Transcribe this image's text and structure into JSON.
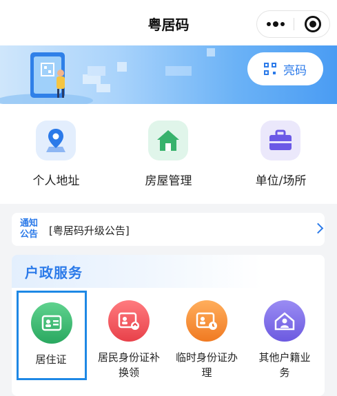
{
  "nav": {
    "title": "粤居码"
  },
  "banner": {
    "button_label": "亮码",
    "button_icon": "qr-code-icon"
  },
  "quick_items": [
    {
      "label": "个人地址",
      "icon": "location-pin-icon",
      "color": "#2b7ae9"
    },
    {
      "label": "房屋管理",
      "icon": "house-icon",
      "color": "#37b26c"
    },
    {
      "label": "单位/场所",
      "icon": "briefcase-icon",
      "color": "#6b59e6"
    }
  ],
  "notice": {
    "tag": "通知公告",
    "text": "[粤居码升级公告]"
  },
  "household": {
    "title": "户政服务",
    "items": [
      {
        "label": "居住证",
        "icon": "residence-permit-card-icon",
        "color": "#2fb46a",
        "selected": true
      },
      {
        "label": "居民身份证补换领",
        "icon": "id-card-replacement-icon",
        "color": "#ef5257",
        "selected": false
      },
      {
        "label": "临时身份证办理",
        "icon": "temporary-id-card-icon",
        "color": "#f3892d",
        "selected": false
      },
      {
        "label": "其他户籍业务",
        "icon": "household-registration-icon",
        "color": "#7b6ae8",
        "selected": false
      }
    ]
  }
}
